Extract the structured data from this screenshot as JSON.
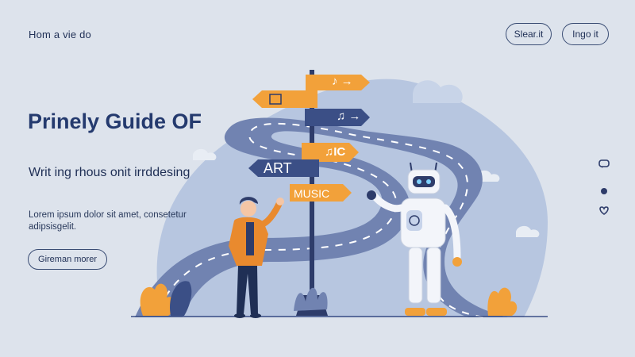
{
  "header": {
    "brand": "Hom a vie do",
    "search_label": "Slear.it",
    "login_label": "Ingo it"
  },
  "hero": {
    "title": "Prinely Guide OF",
    "subtitle": "Writ ing rhous onit irrddesing",
    "body": "Lorem ipsum dolor sit amet, consetetur adipsisgelit.",
    "cta_label": "Gireman morer"
  },
  "signs": {
    "art": "ART",
    "music": "MUSIC",
    "music_icon": "♫IC",
    "note_top": "♪ →",
    "note_mid": "♫ →"
  },
  "side_icons": [
    "chat-icon",
    "dot-icon",
    "heart-icon"
  ],
  "colors": {
    "background": "#dde3ec",
    "navy": "#3b4f86",
    "orange": "#f2a13a",
    "road": "#6f84b2"
  }
}
